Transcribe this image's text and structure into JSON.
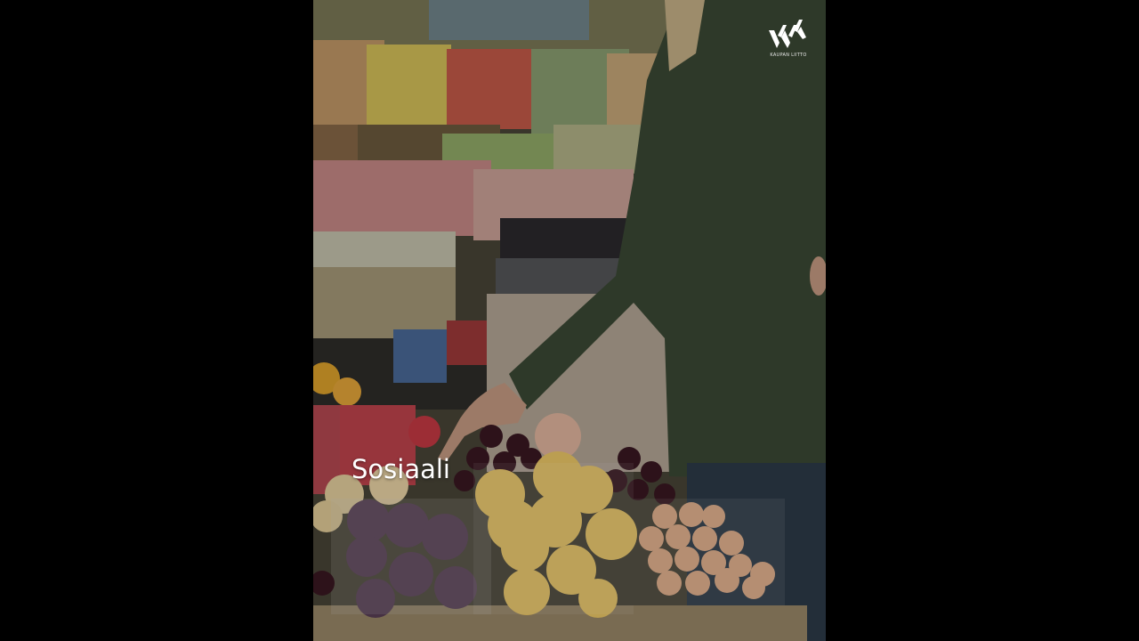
{
  "video": {
    "caption": "Sosiaali",
    "description_icon": "market-fruit-photo"
  },
  "logo": {
    "text": "KAUPAN LIITTO",
    "icon": "kaupan-liitto-logo-icon"
  },
  "colors": {
    "letterbox": "#000000",
    "caption": "#ffffff",
    "sweater": "#3b4a35"
  }
}
